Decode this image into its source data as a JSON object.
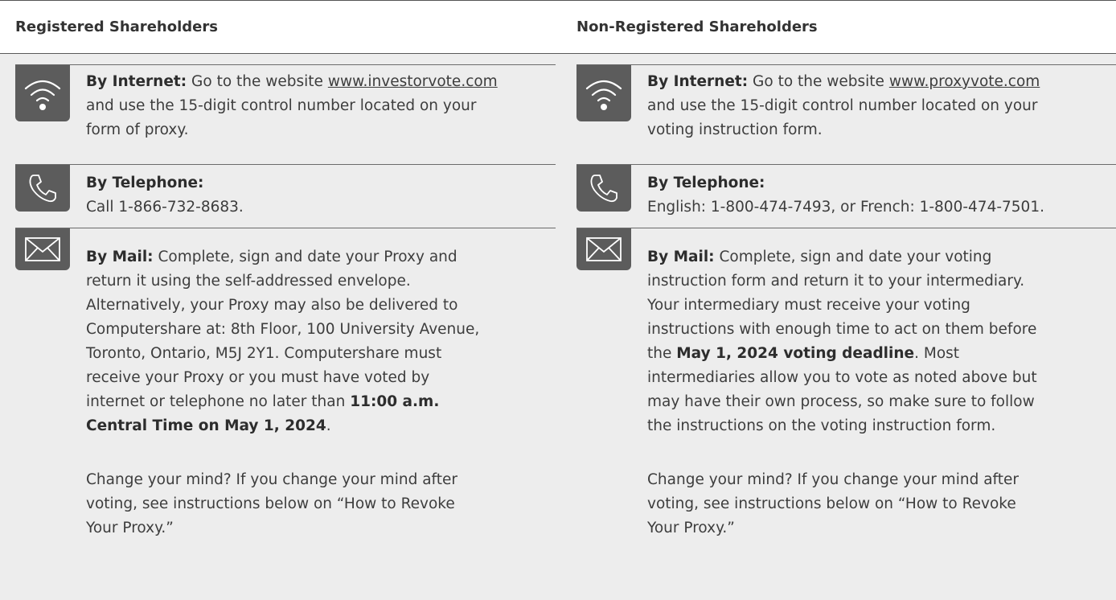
{
  "headers": {
    "registered": "Registered Shareholders",
    "non_registered": "Non-Registered Shareholders"
  },
  "registered": {
    "internet": {
      "label": "By Internet:",
      "text_before_link": "Go to the website",
      "link": "www.investorvote.com",
      "line2": "and use the 15-digit control number located on your",
      "line3": "form of proxy."
    },
    "telephone": {
      "label": "By Telephone:",
      "text": "Call 1-866-732-8683."
    },
    "mail": {
      "label": "By Mail:",
      "line1": "Complete, sign and date your Proxy and",
      "line2": "return it using the self-addressed envelope.",
      "line3": "Alternatively, your Proxy may also be delivered to",
      "line4": "Computershare at: 8th Floor, 100 University Avenue,",
      "line5": "Toronto, Ontario, M5J 2Y1. Computershare must",
      "line6": "receive your Proxy or you must have voted by",
      "line7_pre": "internet or telephone no later than",
      "line7_bold": "11:00 a.m.",
      "line8_bold": "Central Time on May 1, 2024",
      "line8_post": "."
    },
    "change": {
      "line1": "Change your mind? If you change your mind after",
      "line2": "voting, see instructions below on “How to Revoke",
      "line3": "Your Proxy.”"
    }
  },
  "non_registered": {
    "internet": {
      "label": "By Internet:",
      "text_before_link": "Go to the website",
      "link": "www.proxyvote.com",
      "line2": "and use the 15-digit control number located on your",
      "line3": "voting instruction form."
    },
    "telephone": {
      "label": "By Telephone:",
      "text": "English: 1-800-474-7493, or French: 1-800-474-7501."
    },
    "mail": {
      "label": "By Mail:",
      "line1": "Complete, sign and date your voting",
      "line2": "instruction form and return it to your intermediary.",
      "line3": "Your intermediary must receive your voting",
      "line4": "instructions with enough time to act on them before",
      "line5_pre": "the",
      "line5_bold": "May 1, 2024 voting deadline",
      "line5_post": ". Most",
      "line6": "intermediaries allow you to vote as noted above but",
      "line7": "may have their own process, so make sure to follow",
      "line8": "the instructions on the voting instruction form."
    },
    "change": {
      "line1": "Change your mind? If you change your mind after",
      "line2": "voting, see instructions below on “How to Revoke",
      "line3": "Your Proxy.”"
    }
  },
  "icons": {
    "internet": "wifi-icon",
    "telephone": "phone-icon",
    "mail": "envelope-icon"
  },
  "colors": {
    "icon_tab": "#5c5c5c",
    "background": "#ededed",
    "header_background": "#ffffff"
  }
}
